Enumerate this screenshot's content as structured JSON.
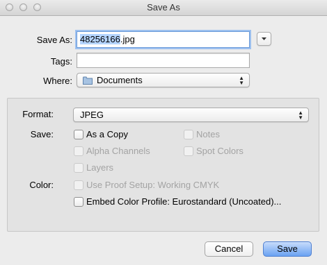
{
  "window": {
    "title": "Save As"
  },
  "form": {
    "save_as_label": "Save As:",
    "filename_selected": "48256166",
    "filename_ext": ".jpg",
    "tags_label": "Tags:",
    "tags_value": "",
    "where_label": "Where:",
    "where_value": "Documents"
  },
  "options": {
    "format_label": "Format:",
    "format_value": "JPEG",
    "save_label": "Save:",
    "as_copy": "As a Copy",
    "notes": "Notes",
    "alpha_channels": "Alpha Channels",
    "spot_colors": "Spot Colors",
    "layers": "Layers",
    "color_label": "Color:",
    "use_proof_setup": "Use Proof Setup:  Working CMYK",
    "embed_color_profile": "Embed Color Profile:  Eurostandard (Uncoated)..."
  },
  "buttons": {
    "cancel": "Cancel",
    "save": "Save"
  },
  "icons": {
    "expand": "chevron-down-icon",
    "folder": "folder-icon",
    "popup_arrows": "up-down-arrows-icon"
  }
}
